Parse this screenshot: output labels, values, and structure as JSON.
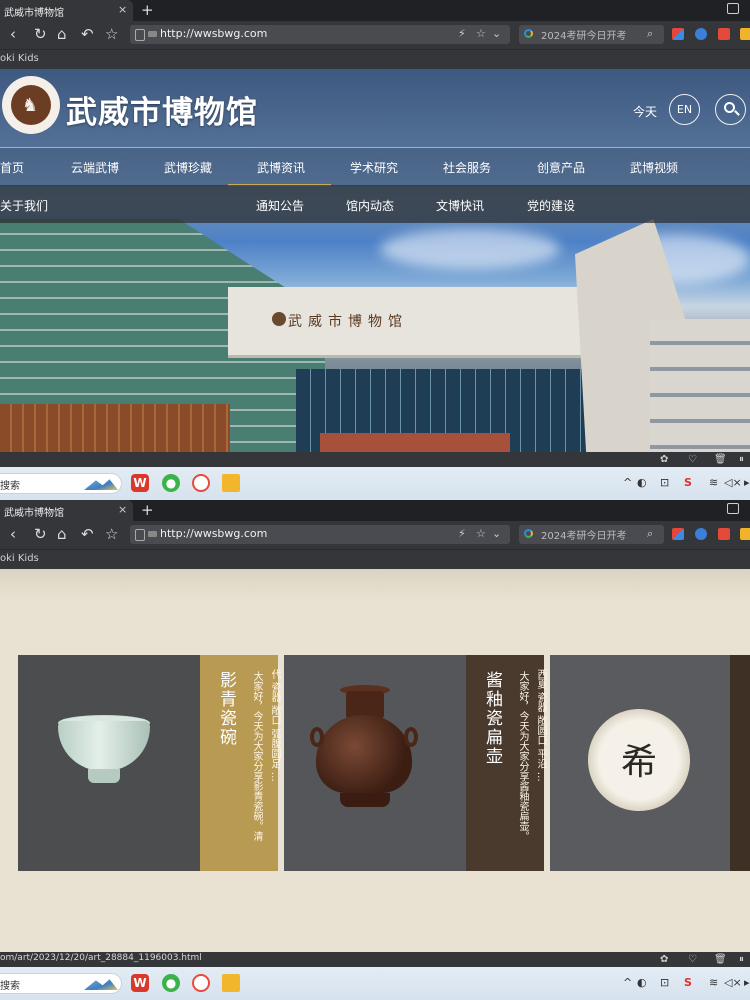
{
  "browser": {
    "tab_title": "武威市博物馆",
    "tab_close": "×",
    "new_tab": "+",
    "nav_back": "‹",
    "nav_reload": "↻",
    "nav_home": "⌂",
    "nav_undo": "↶",
    "nav_star": "☆",
    "address_url": "http://wwsbwg.com",
    "addr_icons": {
      "lightning": "⚡",
      "star": "☆",
      "dropdown": "⌄"
    },
    "search_text": "2024考研今日开考",
    "search_icon": "⌕",
    "bookmarks_text": "oki Kids",
    "status_url_2": "om/art/2023/12/20/art_28884_1196003.html",
    "status_icons": [
      "✿",
      "♡",
      "🗑",
      "⏸"
    ]
  },
  "site_header": {
    "logo_title": "武威市博物馆",
    "today": "今天",
    "en": "EN"
  },
  "nav": [
    "首页",
    "云端武博",
    "武博珍藏",
    "武博资讯",
    "学术研究",
    "社会服务",
    "创意产品",
    "武博视频"
  ],
  "nav_active_index": 3,
  "subnav": [
    "关于我们",
    "通知公告",
    "馆内动态",
    "文博快讯",
    "党的建设"
  ],
  "building_sign": "武威市博物馆",
  "cards": [
    {
      "title": "影青瓷碗",
      "desc": "大家好，今天为大家分享影青瓷碗。清",
      "tag": "代 瓷器 敞口 弧腹圆足 …",
      "color": "#b89a52"
    },
    {
      "title": "酱釉瓷扁壶",
      "desc": "大家好，今天为大家分享酱釉瓷扁壶。",
      "tag": "西夏 瓷器 敞圆口 平沿 …",
      "color": "#4a3a2e"
    }
  ],
  "card3_glyph": "希",
  "taskbar": {
    "search_label": "搜索",
    "apps": [
      {
        "name": "wps",
        "label": "W",
        "color": "#d9382b"
      },
      {
        "name": "wechat",
        "label": "●",
        "color": "#3cb34a"
      },
      {
        "name": "chrome",
        "label": "◉",
        "color": "#e84a3b"
      },
      {
        "name": "folder",
        "label": "▭",
        "color": "#f2b62d"
      }
    ],
    "tray": [
      "^",
      "◐",
      "⊡",
      "S",
      "≋",
      "◁×",
      "▸"
    ]
  }
}
